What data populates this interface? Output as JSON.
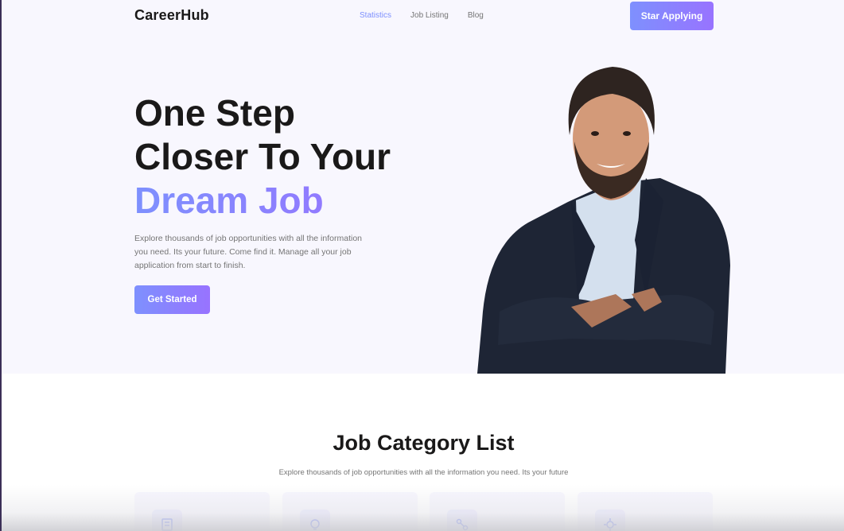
{
  "brand": {
    "name": "CareerHub"
  },
  "nav": {
    "links": [
      {
        "label": "Statistics",
        "active": true
      },
      {
        "label": "Job Listing",
        "active": false
      },
      {
        "label": "Blog",
        "active": false
      }
    ],
    "cta_label": "Star Applying"
  },
  "hero": {
    "title_line1": "One Step",
    "title_line2": "Closer To Your",
    "title_accent": "Dream Job",
    "description": "Explore thousands of job opportunities with all the information you need. Its your future. Come find it. Manage all your job application from start to finish.",
    "button_label": "Get Started"
  },
  "categories": {
    "title": "Job Category List",
    "subtitle": "Explore thousands of job opportunities with all the information you need. Its your future",
    "icons": [
      "accounts-icon",
      "creative-icon",
      "marketing-icon",
      "engineering-icon"
    ]
  },
  "colors": {
    "accent_start": "#7e90fe",
    "accent_end": "#9873ff",
    "hero_bg": "#f8f7fe",
    "heading": "#1a1919",
    "body_text": "#757575"
  }
}
